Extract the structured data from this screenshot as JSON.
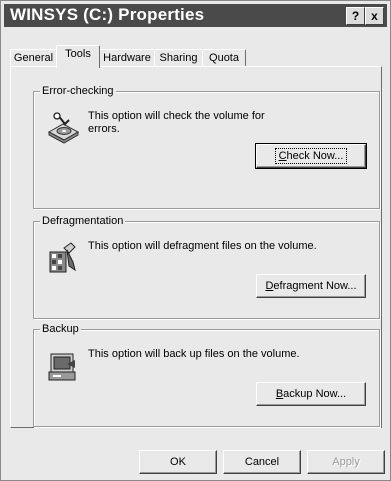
{
  "window": {
    "title": "WINSYS (C:) Properties",
    "help_button": "?",
    "close_button": "x"
  },
  "tabs": [
    {
      "label": "General",
      "active": false
    },
    {
      "label": "Tools",
      "active": true
    },
    {
      "label": "Hardware",
      "active": false
    },
    {
      "label": "Sharing",
      "active": false
    },
    {
      "label": "Quota",
      "active": false
    }
  ],
  "sections": {
    "error_checking": {
      "title": "Error-checking",
      "description": "This option will check the volume for errors.",
      "button": {
        "accel": "C",
        "rest": "heck Now..."
      },
      "icon": "disk-check-icon"
    },
    "defragmentation": {
      "title": "Defragmentation",
      "description": "This option will defragment files on the volume.",
      "button": {
        "accel": "D",
        "rest": "efragment Now..."
      },
      "icon": "defragment-icon"
    },
    "backup": {
      "title": "Backup",
      "description": "This option will back up files on the volume.",
      "button": {
        "accel": "B",
        "rest": "ackup Now..."
      },
      "icon": "backup-icon"
    }
  },
  "footer": {
    "ok": "OK",
    "cancel": "Cancel",
    "apply": "Apply"
  }
}
